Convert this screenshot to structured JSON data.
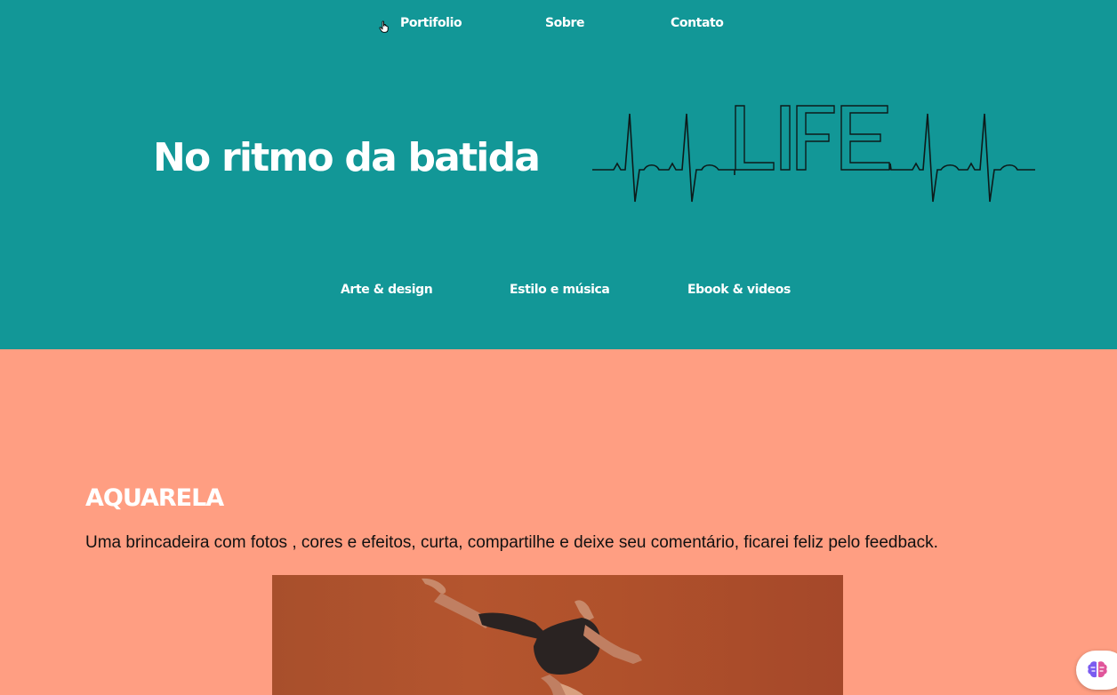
{
  "nav": {
    "items": [
      {
        "label": "Portifolio"
      },
      {
        "label": "Sobre"
      },
      {
        "label": "Contato"
      }
    ]
  },
  "hero": {
    "title": "No ritmo da batida",
    "logo_text": "LIFE"
  },
  "sub_nav": {
    "items": [
      {
        "label": "Arte & design"
      },
      {
        "label": "Estilo e música"
      },
      {
        "label": "Ebook & videos"
      }
    ]
  },
  "section": {
    "title": "AQUARELA",
    "text": "Uma brincadeira com fotos , cores e efeitos, curta, compartilhe e deixe seu comentário, ficarei feliz pelo feedback."
  },
  "colors": {
    "header_bg": "#129797",
    "content_bg": "#ff9e82",
    "photo_bg": "#b0512b"
  },
  "icons": {
    "cursor": "hand-pointer-icon",
    "assistant": "brain-icon"
  }
}
